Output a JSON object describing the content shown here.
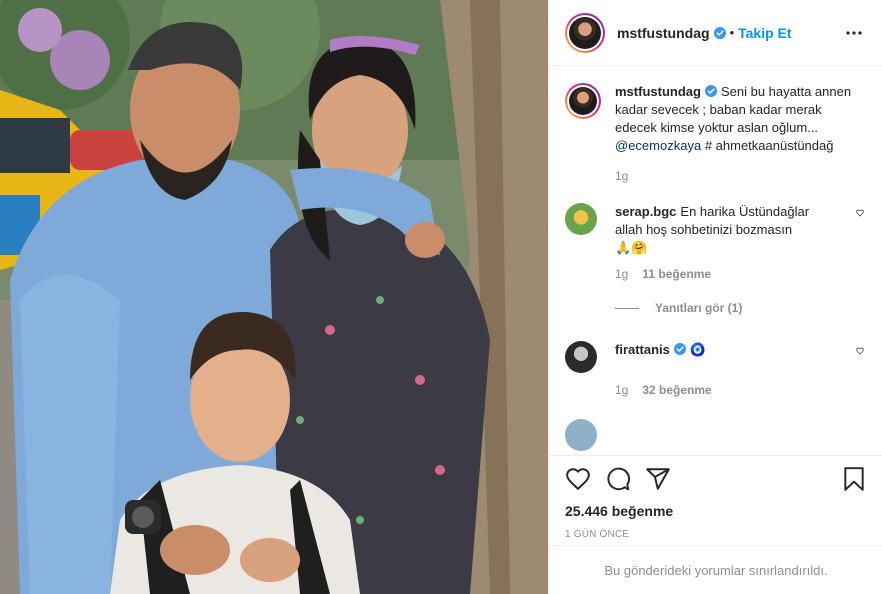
{
  "header": {
    "username": "mstfustundag",
    "follow_label": "Takip Et",
    "separator": "•"
  },
  "caption": {
    "username": "mstfustundag",
    "text": "Seni bu hayatta annen kadar sevecek ; baban kadar merak edecek kimse yoktur aslan oğlum...",
    "mention": "@ecemozkaya",
    "hashtag": "# ahmetkaanüstündağ",
    "time": "1g"
  },
  "comments": [
    {
      "username": "serap.bgc",
      "text": "En harika Üstündağlar allah hoş sohbetinizi bozmasın",
      "emoji": "🙏🤗",
      "time": "1g",
      "likes": "11 beğenme",
      "replies": "Yanıtları gör (1)"
    },
    {
      "username": "firattanis",
      "emoji": "🧿",
      "time": "1g",
      "likes": "32 beğenme"
    }
  ],
  "actions": {
    "likes_count": "25.446 beğenme",
    "post_time": "1 GÜN ÖNCE"
  },
  "footer": {
    "limited_text": "Bu gönderideki yorumlar sınırlandırıldı."
  },
  "icons": {
    "verified": "verified-badge-icon",
    "more": "more-options-icon",
    "like": "heart-icon",
    "comment": "comment-icon",
    "share": "share-icon",
    "save": "bookmark-icon"
  },
  "colors": {
    "accent": "#0095f6",
    "text": "#262626",
    "muted": "#8e8e8e",
    "border": "#efefef",
    "mention": "#00376b"
  }
}
